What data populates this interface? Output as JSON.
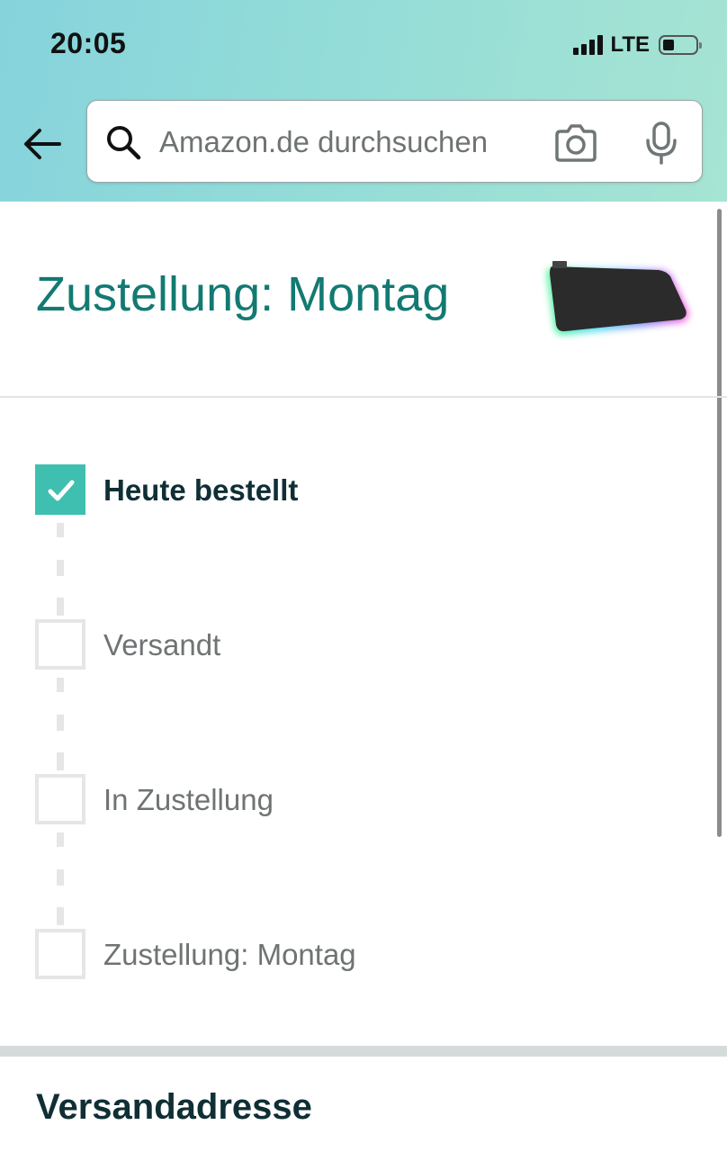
{
  "status_bar": {
    "time": "20:05",
    "network": "LTE"
  },
  "search": {
    "placeholder": "Amazon.de durchsuchen",
    "value": ""
  },
  "delivery": {
    "title": "Zustellung: Montag"
  },
  "steps": [
    {
      "label": "Heute bestellt",
      "checked": true
    },
    {
      "label": "Versandt",
      "checked": false
    },
    {
      "label": "In Zustellung",
      "checked": false
    },
    {
      "label": "Zustellung: Montag",
      "checked": false
    }
  ],
  "shipping": {
    "section_title": "Versandadresse"
  },
  "icons": {
    "back": "arrow-left-icon",
    "search": "search-icon",
    "camera": "camera-icon",
    "mic": "microphone-icon",
    "check": "check-icon"
  },
  "colors": {
    "accent": "#127a72",
    "checked": "#3fbfb0"
  }
}
